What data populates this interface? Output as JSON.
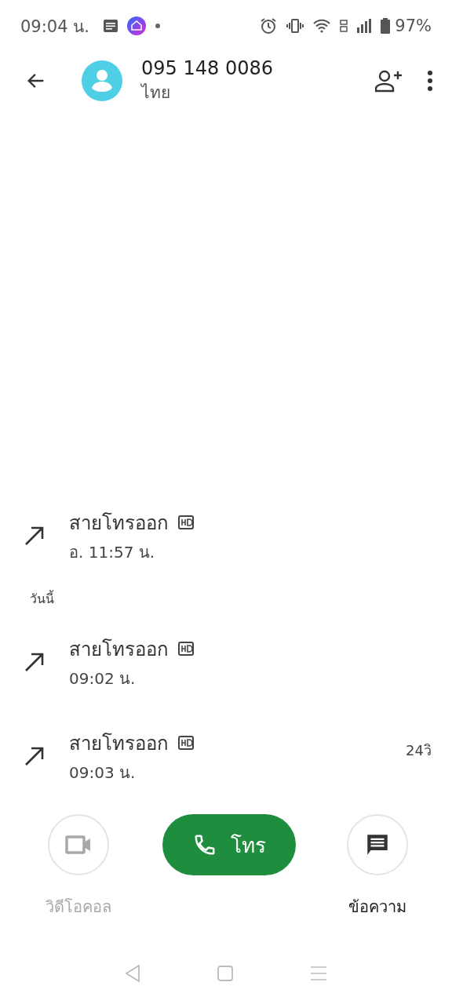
{
  "status_bar": {
    "time": "09:04 น.",
    "battery": "97%"
  },
  "contact": {
    "number": "095 148 0086",
    "country": "ไทย"
  },
  "calls": [
    {
      "kind": "call",
      "type": "สายโทรออก",
      "time": "อ. 11:57 น.",
      "hd": true
    },
    {
      "kind": "header",
      "label": "วันนี้"
    },
    {
      "kind": "call",
      "type": "สายโทรออก",
      "time": "09:02 น.",
      "hd": true
    },
    {
      "kind": "call",
      "type": "สายโทรออก",
      "time": "09:03 น.",
      "hd": true,
      "duration": "24วิ"
    }
  ],
  "actions": [
    {
      "kind": "video",
      "label": "วิดีโอคอล",
      "disabled": true
    },
    {
      "kind": "call",
      "label": "โทร",
      "disabled": false
    },
    {
      "kind": "message",
      "label": "ข้อความ",
      "disabled": false
    }
  ]
}
